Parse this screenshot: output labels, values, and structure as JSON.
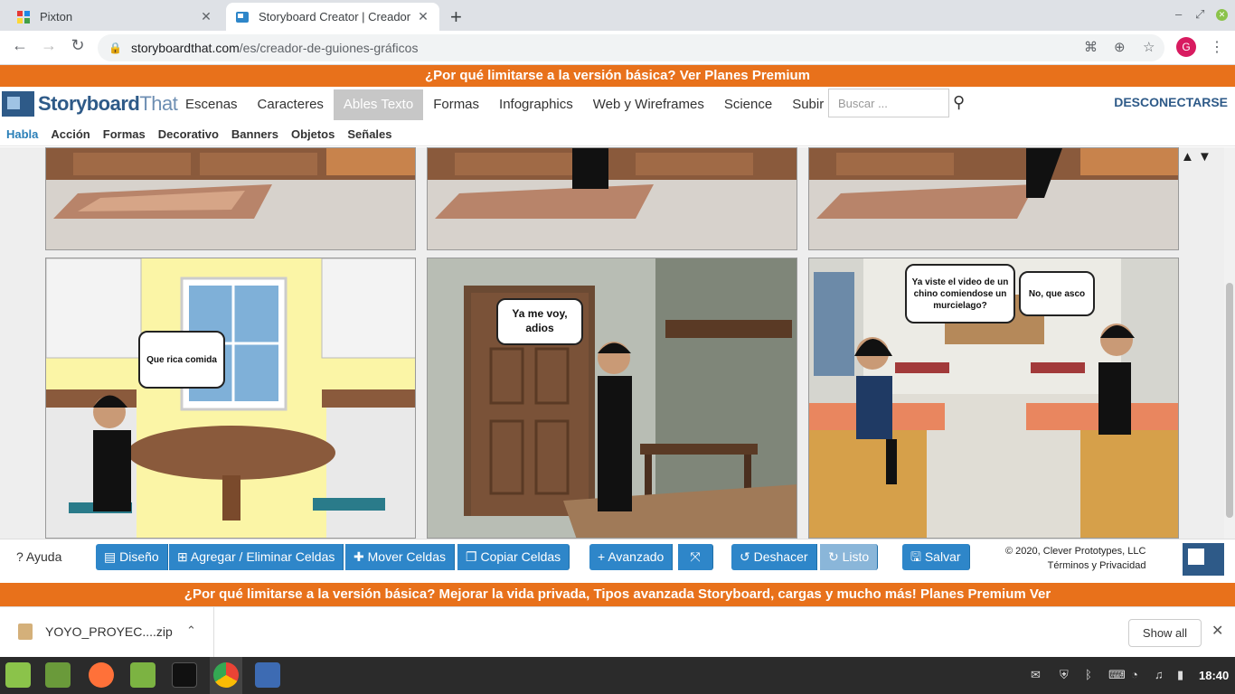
{
  "browser": {
    "tabs": [
      {
        "title": "Pixton",
        "active": false
      },
      {
        "title": "Storyboard Creator | Creador",
        "active": true
      }
    ],
    "new_tab": "+",
    "url_host": "storyboardthat.com",
    "url_path": "/es/creador-de-guiones-gráficos",
    "profile_initial": "G",
    "window_controls": [
      "–",
      "⤢",
      "✕"
    ]
  },
  "promo_top": "¿Por qué limitarse a la versión básica? Ver Planes Premium",
  "header": {
    "logo_storyboard": "Storyboard",
    "logo_that": "That",
    "nav": [
      "Escenas",
      "Caracteres",
      "Ables Texto",
      "Formas",
      "Infographics",
      "Web y Wireframes",
      "Science",
      "Subir"
    ],
    "active_nav": "Ables Texto",
    "search_placeholder": "Buscar ...",
    "logout": "DESCONECTARSE"
  },
  "subnav": {
    "items": [
      "Habla",
      "Acción",
      "Formas",
      "Decorativo",
      "Banners",
      "Objetos",
      "Señales"
    ],
    "active": "Habla"
  },
  "panels": {
    "bubble_kitchen": "Que rica comida",
    "bubble_door": "Ya me voy, adios",
    "bubble_class_1": "Ya viste el video de un chino comiendose un murcielago?",
    "bubble_class_2": "No, que asco"
  },
  "scroll_arrows": "▲ ▼",
  "bottombar": {
    "help": "Ayuda",
    "buttons": {
      "diseno": "Diseño",
      "agregar": "Agregar / Eliminar Celdas",
      "mover": "Mover Celdas",
      "copiar": "Copiar Celdas",
      "avanzado": "Avanzado",
      "deshacer": "Deshacer",
      "listo": "Listo",
      "salvar": "Salvar"
    },
    "copyright": "© 2020, Clever Prototypes, LLC",
    "terms": "Términos y Privacidad"
  },
  "promo_bottom": "¿Por qué limitarse a la versión básica? Mejorar la vida privada, Tipos avanzada Storyboard, cargas y mucho más! Planes Premium Ver",
  "downloads": {
    "file": "YOYO_PROYEC....zip",
    "show_all": "Show all"
  },
  "taskbar": {
    "clock": "18:40"
  },
  "colors": {
    "orange": "#e8711b",
    "blue": "#2e86c9",
    "brand": "#2e5a88"
  }
}
